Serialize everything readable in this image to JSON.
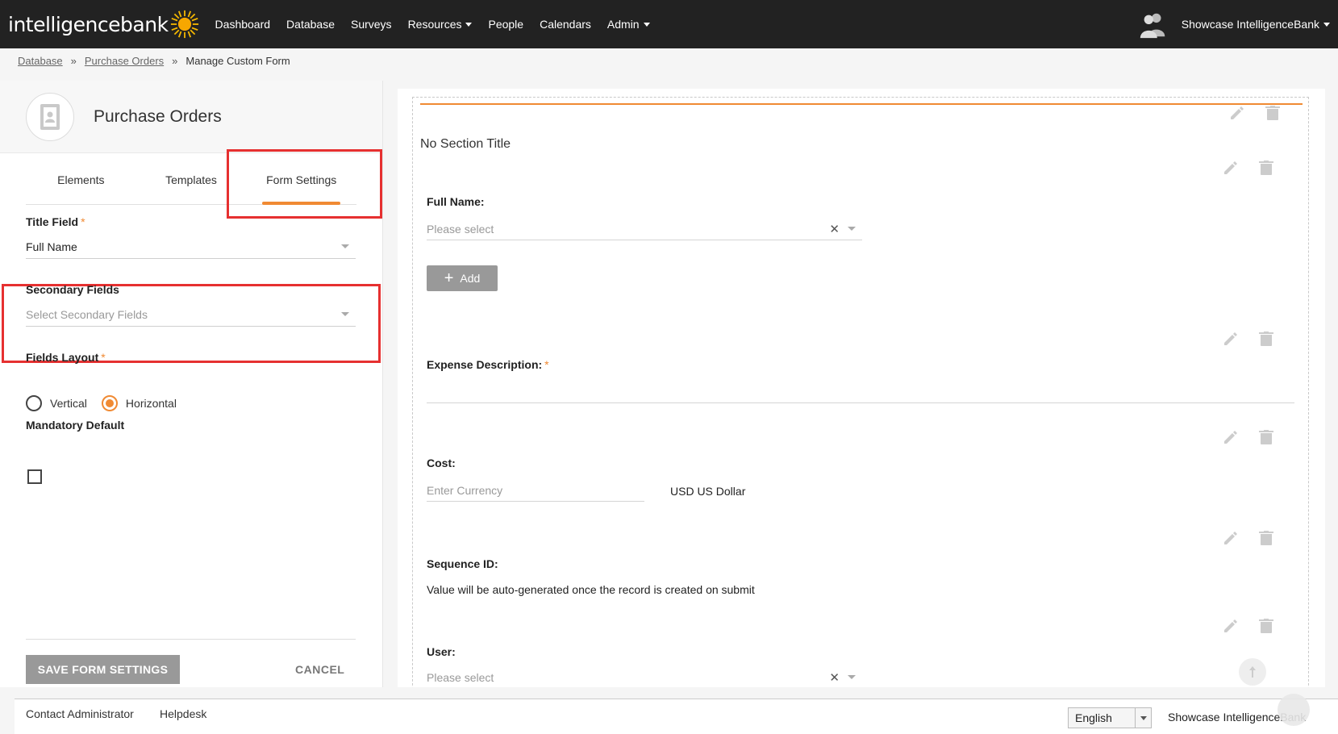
{
  "header": {
    "logo_text": "intelligencebank",
    "nav": [
      {
        "label": "Dashboard",
        "dropdown": false
      },
      {
        "label": "Database",
        "dropdown": false
      },
      {
        "label": "Surveys",
        "dropdown": false
      },
      {
        "label": "Resources",
        "dropdown": true
      },
      {
        "label": "People",
        "dropdown": false
      },
      {
        "label": "Calendars",
        "dropdown": false
      },
      {
        "label": "Admin",
        "dropdown": true
      }
    ],
    "user_name": "Showcase IntelligenceBank"
  },
  "breadcrumb": {
    "items": [
      "Database",
      "Purchase Orders"
    ],
    "separator": "»",
    "current": "Manage Custom Form"
  },
  "left_panel": {
    "title": "Purchase Orders",
    "tabs": [
      {
        "label": "Elements",
        "active": false
      },
      {
        "label": "Templates",
        "active": false
      },
      {
        "label": "Form Settings",
        "active": true
      }
    ],
    "title_field": {
      "label": "Title Field",
      "required": "*",
      "value": "Full Name"
    },
    "secondary_fields": {
      "label": "Secondary Fields",
      "placeholder": "Select Secondary Fields"
    },
    "fields_layout": {
      "label": "Fields Layout",
      "required": "*",
      "options": [
        "Vertical",
        "Horizontal"
      ],
      "selected": "Horizontal"
    },
    "mandatory_default": {
      "label": "Mandatory Default",
      "checked": false
    },
    "save_label": "SAVE FORM SETTINGS",
    "cancel_label": "CANCEL"
  },
  "form": {
    "section_title": "No Section Title",
    "fields": {
      "full_name": {
        "label": "Full Name:",
        "placeholder": "Please select",
        "add_label": "Add"
      },
      "expense_description": {
        "label": "Expense Description:",
        "required": "*"
      },
      "cost": {
        "label": "Cost:",
        "placeholder": "Enter Currency",
        "currency": "USD US Dollar"
      },
      "sequence_id": {
        "label": "Sequence ID:",
        "note": "Value will be auto-generated once the record is created on submit"
      },
      "user": {
        "label": "User:",
        "placeholder": "Please select"
      }
    },
    "clear_symbol": "✕"
  },
  "footer": {
    "links": [
      "Contact Administrator",
      "Helpdesk"
    ],
    "language": "English",
    "brand": "Showcase IntelligenceBank"
  },
  "colors": {
    "accent": "#f08a33",
    "highlight": "#e63030",
    "topbar": "#222222",
    "button_gray": "#999999"
  }
}
